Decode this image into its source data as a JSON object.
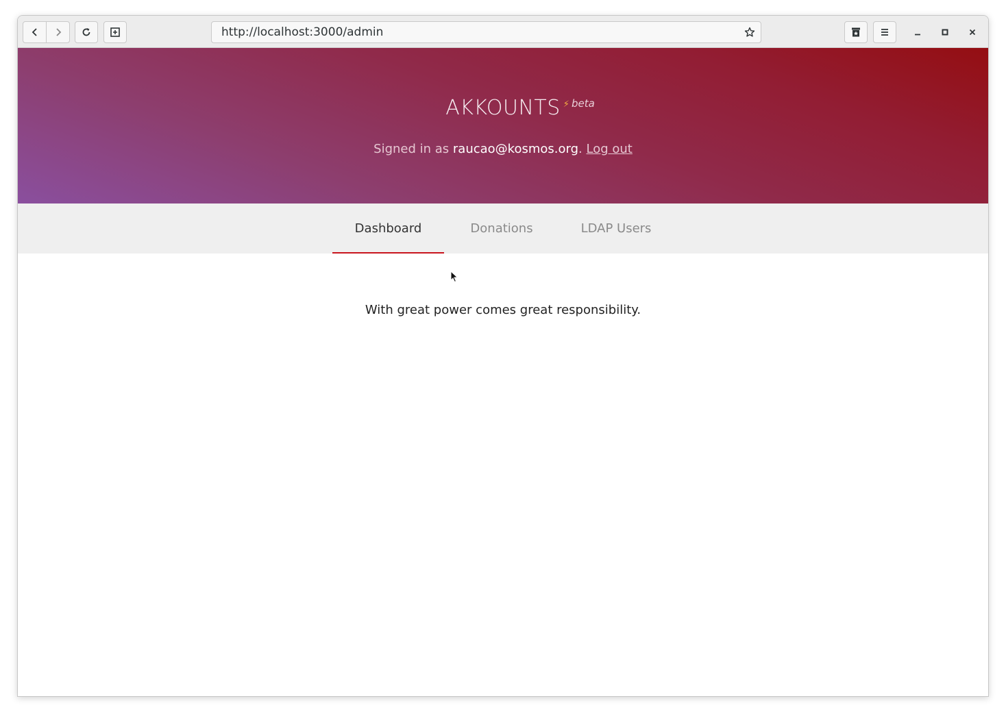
{
  "browser": {
    "url": "http://localhost:3000/admin",
    "buttons": {
      "back": "back-icon",
      "forward": "forward-icon",
      "reload": "reload-icon",
      "new_tab": "new-tab-icon",
      "bookmark": "star-icon",
      "bookmarks_menu": "bookmarks-icon",
      "menu": "hamburger-menu-icon"
    },
    "window_controls": [
      "minimize-icon",
      "maximize-icon",
      "close-icon"
    ]
  },
  "header": {
    "app_title": "AKKOUNTS",
    "beta_label": "beta",
    "signed_in_prefix": "Signed in as",
    "user_email": "raucao@kosmos.org",
    "separator": ".",
    "logout_label": "Log out"
  },
  "nav": {
    "tabs": [
      {
        "label": "Dashboard",
        "active": true
      },
      {
        "label": "Donations",
        "active": false
      },
      {
        "label": "LDAP Users",
        "active": false
      }
    ]
  },
  "main": {
    "tagline": "With great power comes great responsibility."
  },
  "colors": {
    "hero_gradient_start": "#8a4f9e",
    "hero_gradient_end": "#940e12",
    "active_tab_underline": "#c8141c",
    "tab_bar_bg": "#efefef"
  }
}
